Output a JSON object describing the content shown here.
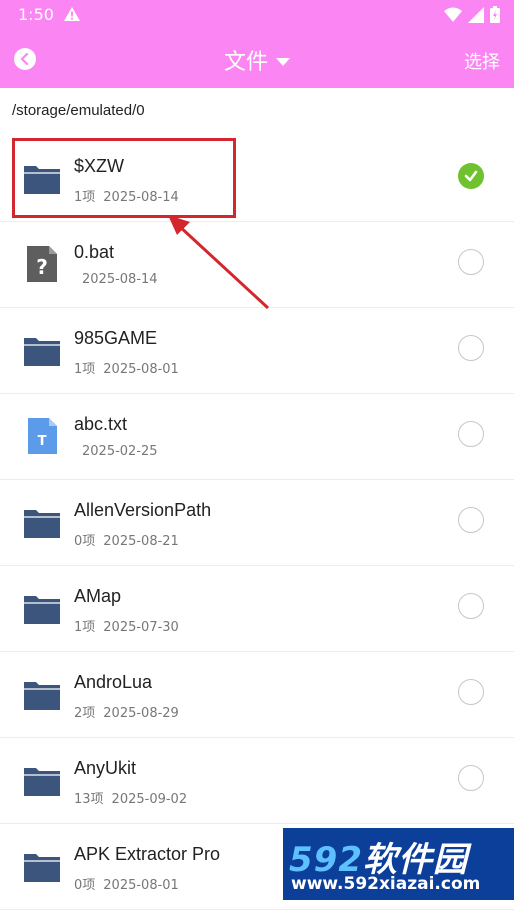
{
  "status_bar": {
    "time": "1:50",
    "icons": [
      "alert-triangle-icon",
      "wifi-icon",
      "cell-signal-icon",
      "battery-icon"
    ]
  },
  "header": {
    "title": "文件",
    "select_label": "选择",
    "back_icon": "back-arrow-icon",
    "title_dropdown_icon": "caret-down-icon"
  },
  "path": "/storage/emulated/0",
  "colors": {
    "header_bg": "#fb86f3",
    "folder_icon": "#3c557d",
    "check_green": "#6fc12e",
    "highlight_red": "#d3272d"
  },
  "files": [
    {
      "name": "$XZW",
      "count": "1项",
      "date": "2025-08-14",
      "type": "folder",
      "selected": true
    },
    {
      "name": "0.bat",
      "count": "",
      "date": "2025-08-14",
      "type": "unknown",
      "selected": false
    },
    {
      "name": "985GAME",
      "count": "1项",
      "date": "2025-08-01",
      "type": "folder",
      "selected": false
    },
    {
      "name": "abc.txt",
      "count": "",
      "date": "2025-02-25",
      "type": "text",
      "selected": false
    },
    {
      "name": "AllenVersionPath",
      "count": "0项",
      "date": "2025-08-21",
      "type": "folder",
      "selected": false
    },
    {
      "name": "AMap",
      "count": "1项",
      "date": "2025-07-30",
      "type": "folder",
      "selected": false
    },
    {
      "name": "AndroLua",
      "count": "2项",
      "date": "2025-08-29",
      "type": "folder",
      "selected": false
    },
    {
      "name": "AnyUkit",
      "count": "13项",
      "date": "2025-09-02",
      "type": "folder",
      "selected": false
    },
    {
      "name": "APK Extractor Pro",
      "count": "0项",
      "date": "2025-08-01",
      "type": "folder",
      "selected": false
    }
  ],
  "watermark": {
    "number": "592",
    "brand": "软件园",
    "url": "www.592xiazai.com"
  }
}
